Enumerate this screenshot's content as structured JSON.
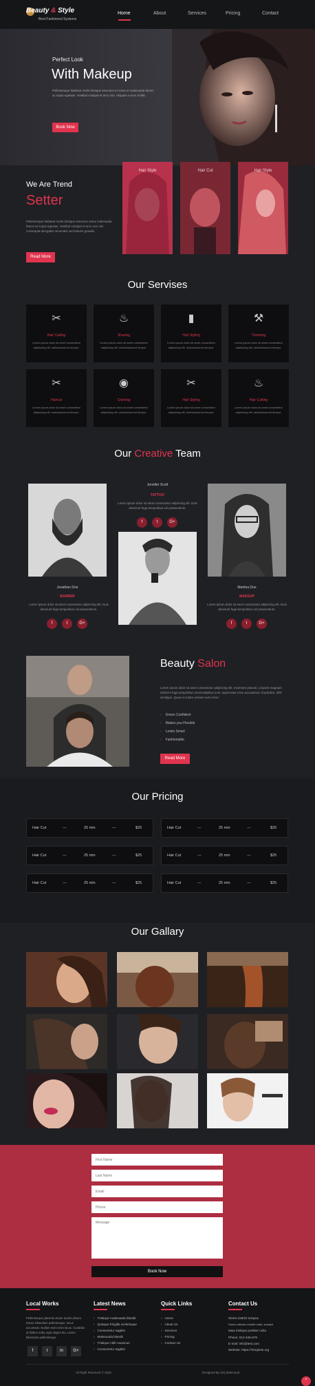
{
  "brand": {
    "name_a": "Beauty ",
    "name_amp": "&",
    "name_b": " Style",
    "tagline": "Best Fashioned Systems"
  },
  "nav": [
    "Home",
    "About",
    "Services",
    "Pricing",
    "Contact"
  ],
  "hero": {
    "small": "Perfect Look",
    "big": "With Makeup",
    "text": "Pellentesque habitant morbi tristique senectus et netus et malesuada fames ac turpis egestas. Vestibul volutpat et arcu non. Aliquam a eros mollis.",
    "button": "Book Now"
  },
  "trend": {
    "small": "We Are Trend",
    "big": "Setter",
    "text": "Pellentesque habitant morbi tristique senectus netus malesuada fames ac turpis egestas. Vestibul volutpat et arcu non nisl consequat dumgattis venenatis sed Mauris gravida.",
    "button": "Read More",
    "cards": [
      "Hair Style",
      "Hair Cut",
      "Hair Style"
    ]
  },
  "services": {
    "title": "Our Servises",
    "items": [
      {
        "icon": "comb-scissors-icon",
        "glyph": "✂",
        "title": "Hair Cutting",
        "text": "Lorem ipsum dolor sit amet consectetur adipiscing elit, seddoeiusmod tempor."
      },
      {
        "icon": "hair-dryer-icon",
        "glyph": "♨",
        "title": "Shaving",
        "text": "Lorem ipsum dolor sit amet consectetur adipiscing elit, seddoeiusmod tempor."
      },
      {
        "icon": "spray-bottle-icon",
        "glyph": "▮",
        "title": "Hair Styling",
        "text": "Lorem ipsum dolor sit amet consectetur adipiscing elit, seddoeiusmod tempor."
      },
      {
        "icon": "razor-icon",
        "glyph": "⚒",
        "title": "Trimming",
        "text": "Lorem ipsum dolor sit amet consectetur adipiscing elit, seddoeiusmod tempor."
      },
      {
        "icon": "scissors-icon",
        "glyph": "✂",
        "title": "Haircut",
        "text": "Lorem ipsum dolor sit amet consectetur adipiscing elit, seddoeiusmod tempor."
      },
      {
        "icon": "hair-product-icon",
        "glyph": "◉",
        "title": "Coloring",
        "text": "Lorem ipsum dolor sit amet consectetur adipiscing elit, seddoeiusmod tempor."
      },
      {
        "icon": "comb-scissors-icon",
        "glyph": "✂",
        "title": "Hair Styling",
        "text": "Lorem ipsum dolor sit amet consectetur adipiscing elit, seddoeiusmod tempor."
      },
      {
        "icon": "hair-dryer-icon",
        "glyph": "♨",
        "title": "Hair Cutting",
        "text": "Lorem ipsum dolor sit amet consectetur adipiscing elit, seddoeiusmod tempor."
      }
    ]
  },
  "team": {
    "title_a": "Our ",
    "title_b": "Creative",
    "title_c": " Team",
    "members": [
      {
        "name": "Jonathan Doe",
        "role": "BARBER",
        "text": "Lorem ipsum dolor sit amet consectetur adipiscing elit. Duis deserunt fuga temporibus vel praesentium."
      },
      {
        "name": "Jennifer Scott",
        "role": "TATTOO",
        "text": "Lorem ipsum dolor sit amet consectetur adipiscing elit. Duis deserunt fuga temporibus vel praesentium."
      },
      {
        "name": "Martina Doe",
        "role": "MAKEUP",
        "text": "Lorem ipsum dolor sit amet consectetur adipiscing elit. Duis deserunt fuga temporibus vel praesentium."
      }
    ],
    "social": [
      "f",
      "t",
      "G+"
    ]
  },
  "salon": {
    "title_a": "Beauty ",
    "title_b": "Salon",
    "text": "Lorem ipsum dolor sit amet consectetur adipiscing elit. Inventore placeat, corporis magnam dolorem fuga temporibus necessitatibus eum, aspernatur esse accusamus. Explicabo, nihil similique. Quas ex totam veniam eum error!",
    "list": [
      "Green Confident",
      "Makes you Flexible",
      "Looks Smart",
      "Fashionable"
    ],
    "button": "Read More"
  },
  "pricing": {
    "title": "Our Pricing",
    "rows": [
      {
        "service": "Hair Cut",
        "sep": "---",
        "time": "25 min",
        "price": "$25"
      },
      {
        "service": "Hair Cut",
        "sep": "---",
        "time": "25 min",
        "price": "$25"
      },
      {
        "service": "Hair Cut",
        "sep": "---",
        "time": "25 min",
        "price": "$25"
      },
      {
        "service": "Hair Cut",
        "sep": "---",
        "time": "25 min",
        "price": "$25"
      },
      {
        "service": "Hair Cut",
        "sep": "---",
        "time": "25 min",
        "price": "$25"
      },
      {
        "service": "Hair Cut",
        "sep": "---",
        "time": "25 min",
        "price": "$25"
      }
    ]
  },
  "gallery": {
    "title": "Our Gallary"
  },
  "contact": {
    "placeholders": [
      "First Name",
      "Last Name",
      "Email",
      "Phone",
      "Message"
    ],
    "button": "Book Now"
  },
  "footer": {
    "col1": {
      "title": "Local Works",
      "text": "Pellentesque placerat ornare iaculis dictum. Donec bibendum pellentesque, lacus accumsan. Nullam enim enim lacus. Curabitur at finibus nulla, eget aliquet dui. Lorem bibendum pellentesque."
    },
    "col2": {
      "title": "Latest News",
      "items": [
        "Tristique malesuada blandit",
        "Quisque fringilla scelerisque",
        "Consectetur sagittis",
        "Malesuada blandit",
        "Tristique nibh maximus",
        "Consectetur sagittis"
      ]
    },
    "col3": {
      "title": "Quick Links",
      "items": [
        "Home",
        "About Us",
        "Services",
        "Pricing",
        "Contact Us"
      ]
    },
    "col4": {
      "title": "Contact Us",
      "lines": [
        "Street 228/22 tempus",
        "Donec ultricies eroelte nulla, suscipit",
        "Maw tristique porttitor nulla",
        "Phone:   012-345-678",
        "E-mail:   info@test.com",
        "Website:   https://Templets.org"
      ]
    },
    "social": [
      "f",
      "t",
      "in",
      "G+"
    ],
    "copyright": "All Right Reserved © 2020",
    "designed": "Designed By Sirij Mahmoud"
  }
}
